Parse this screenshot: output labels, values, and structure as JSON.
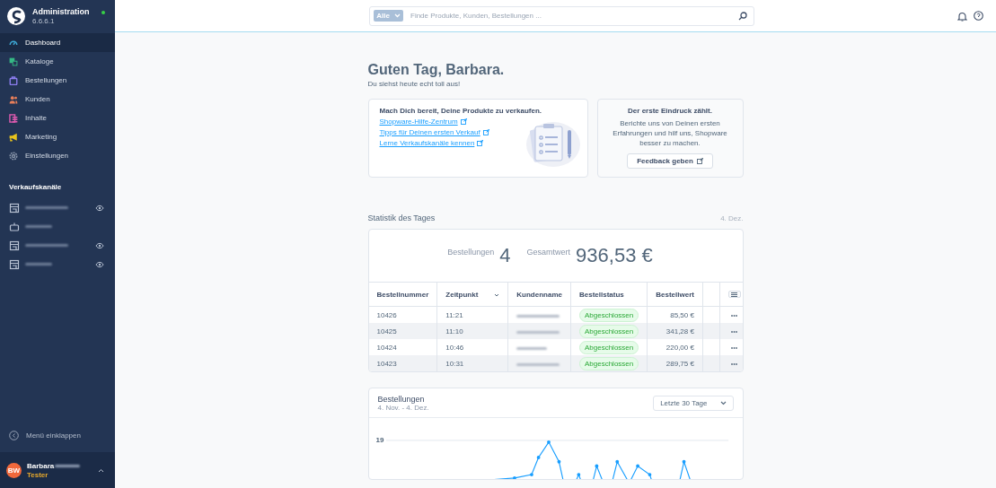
{
  "sidebar": {
    "title": "Administration",
    "version": "6.6.6.1",
    "online": true,
    "items": [
      {
        "label": "Dashboard",
        "color": "#3ea9d6",
        "selected": true
      },
      {
        "label": "Kataloge",
        "color": "#35b985",
        "selected": false
      },
      {
        "label": "Bestellungen",
        "color": "#8c7ef0",
        "selected": false
      },
      {
        "label": "Kunden",
        "color": "#e87f5a",
        "selected": false
      },
      {
        "label": "Inhalte",
        "color": "#e05bb0",
        "selected": false
      },
      {
        "label": "Marketing",
        "color": "#e8c31c",
        "selected": false
      },
      {
        "label": "Einstellungen",
        "color": "#8b97ac",
        "selected": false
      }
    ],
    "channels_title": "Verkaufskanäle",
    "channels": [
      {
        "kind": "store",
        "eye": true
      },
      {
        "kind": "headless",
        "eye": false
      },
      {
        "kind": "store",
        "eye": true
      },
      {
        "kind": "store",
        "eye": true
      }
    ],
    "collapse": "Menü einklappen",
    "user": {
      "initials": "BW",
      "name": "Barbara",
      "role": "Tester"
    }
  },
  "search": {
    "filter": "Alle",
    "placeholder": "Finde Produkte, Kunden, Bestellungen ..."
  },
  "greeting": {
    "title": "Guten Tag, Barbara.",
    "subtitle": "Du siehst heute echt toll aus!"
  },
  "intro_card": {
    "title": "Mach Dich bereit, Deine Produkte zu verkaufen.",
    "links": [
      "Shopware-Hilfe-Zentrum",
      "Tipps für Deinen ersten Verkauf",
      "Lerne Verkaufskanäle kennen"
    ]
  },
  "feedback_card": {
    "title": "Der erste Eindruck zählt.",
    "text": "Berichte uns von Deinen ersten Erfahrungen und hilf uns, Shopware besser zu machen.",
    "button": "Feedback geben"
  },
  "stats": {
    "title": "Statistik des Tages",
    "date": "4. Dez.",
    "orders_label": "Bestellungen",
    "orders": "4",
    "total_label": "Gesamtwert",
    "total": "936,53 €"
  },
  "table": {
    "columns": [
      {
        "label": "Bestellnummer",
        "sorted": false
      },
      {
        "label": "Zeitpunkt",
        "sorted": true
      },
      {
        "label": "Kundenname",
        "sorted": false
      },
      {
        "label": "Bestellstatus",
        "sorted": false
      },
      {
        "label": "Bestellwert",
        "sorted": false
      }
    ],
    "rows": [
      {
        "number": "10426",
        "time": "11:21",
        "status": "Abgeschlossen",
        "value": "85,50 €"
      },
      {
        "number": "10425",
        "time": "11:10",
        "status": "Abgeschlossen",
        "value": "341,28 €"
      },
      {
        "number": "10424",
        "time": "10:46",
        "status": "Abgeschlossen",
        "value": "220,00 €"
      },
      {
        "number": "10423",
        "time": "10:31",
        "status": "Abgeschlossen",
        "value": "289,75 €"
      }
    ]
  },
  "orders_chart": {
    "title": "Bestellungen",
    "range": "4. Nov. - 4. Dez.",
    "period": "Letzte 30 Tage",
    "y_label": "19"
  }
}
